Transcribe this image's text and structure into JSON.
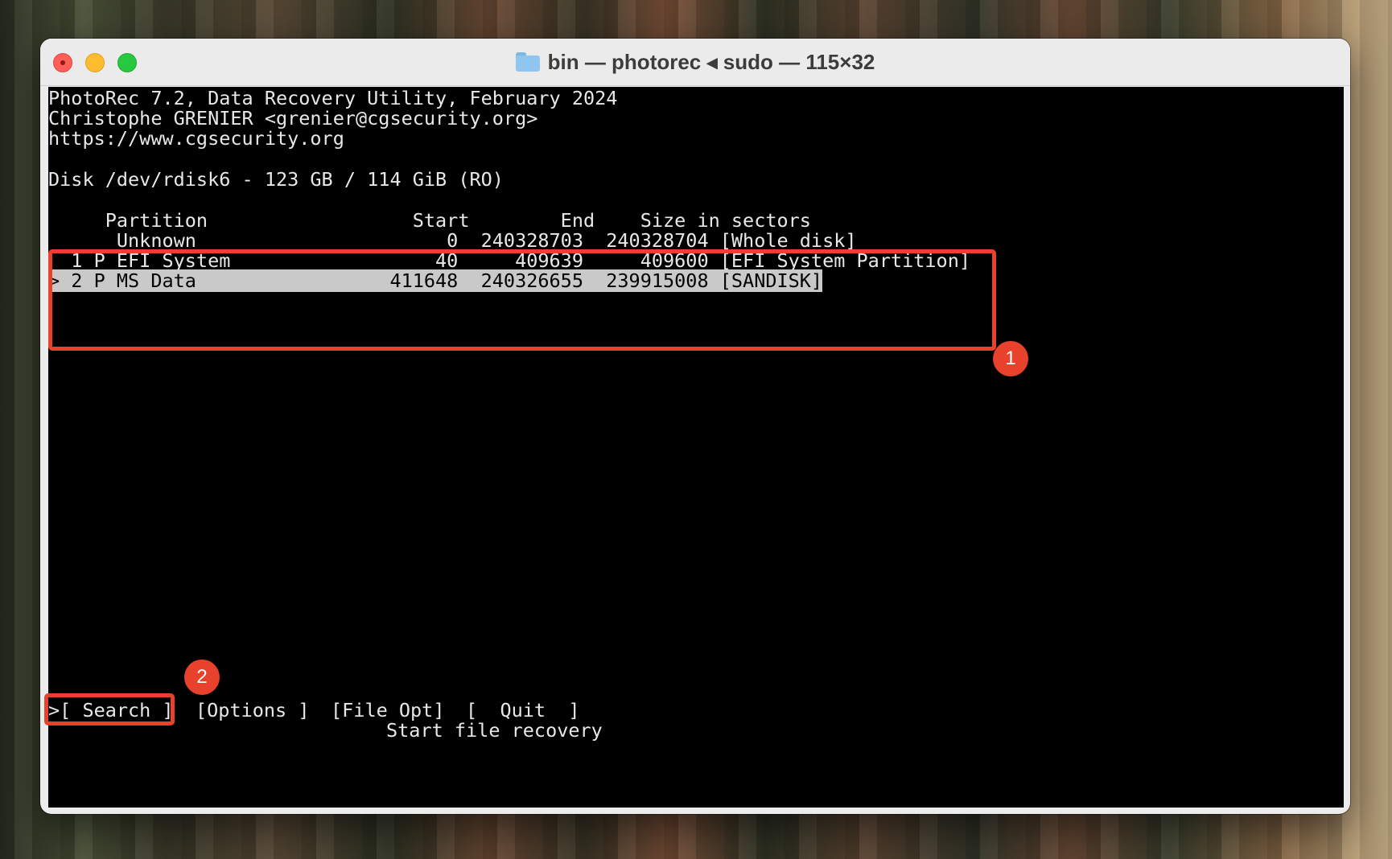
{
  "window": {
    "title": "bin — photorec ◂ sudo — 115×32",
    "folder_icon": "folder-icon"
  },
  "terminal": {
    "header_lines": [
      "PhotoRec 7.2, Data Recovery Utility, February 2024",
      "Christophe GRENIER <grenier@cgsecurity.org>",
      "https://www.cgsecurity.org"
    ],
    "disk_line": "Disk /dev/rdisk6 - 123 GB / 114 GiB (RO)",
    "table": {
      "header": "     Partition                  Start        End    Size in sectors",
      "rows": [
        "      Unknown                      0  240328703  240328704 [Whole disk]",
        "  1 P EFI System                  40     409639     409600 [EFI System Partition]",
        "> 2 P MS Data                 411648  240326655  239915008 [SANDISK]"
      ]
    },
    "menu": {
      "search": ">[ Search ]",
      "options": "[Options ]",
      "file_opt": "[File Opt]",
      "quit": "[  Quit  ]"
    },
    "status": "Start file recovery"
  },
  "annotations": {
    "badge1": "1",
    "badge2": "2",
    "accent_color": "#e8412c"
  }
}
